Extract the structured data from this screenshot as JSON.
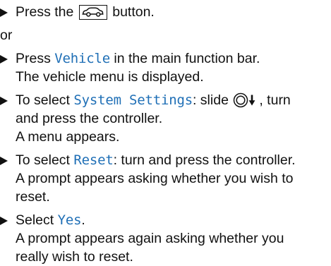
{
  "steps": [
    {
      "type": "action",
      "text_before": "Press the",
      "icon": "car-button-icon",
      "text_after": "button."
    },
    {
      "type": "separator",
      "text": "or"
    },
    {
      "type": "action",
      "text_before": "Press",
      "keyword": "Vehicle",
      "text_after": "in the main function bar.",
      "result": "The vehicle menu is displayed."
    },
    {
      "type": "action",
      "text_before": "To select",
      "keyword": "System Settings",
      "text_mid": ": slide",
      "icon": "controller-slide-down-icon",
      "text_after": ", turn",
      "text_line2": "and press the controller.",
      "result": "A menu appears."
    },
    {
      "type": "action",
      "text_before": "To select",
      "keyword": "Reset",
      "text_after": ": turn and press the controller.",
      "result_line1": "A prompt appears asking whether you wish to",
      "result_line2": "reset."
    },
    {
      "type": "action",
      "text_before": "Select",
      "keyword": "Yes",
      "text_after": ".",
      "result_line1": "A prompt appears again asking whether you",
      "result_line2": "really wish to reset."
    }
  ],
  "colors": {
    "text": "#111111",
    "keyword": "#1f6fb6",
    "background": "#ffffff"
  }
}
